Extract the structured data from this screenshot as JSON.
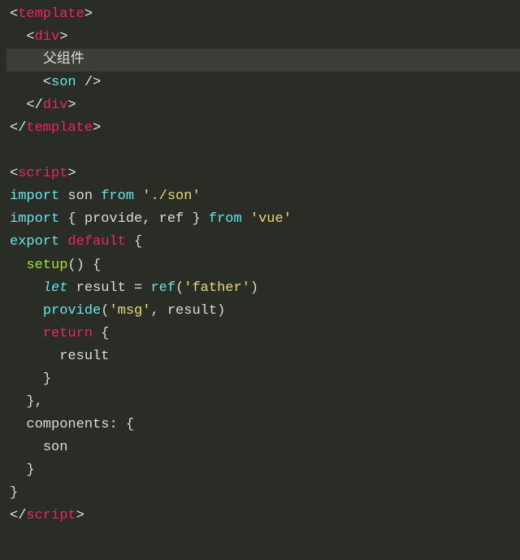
{
  "code": {
    "tags": {
      "template": "template",
      "div": "div",
      "son": "son",
      "script": "script"
    },
    "text": {
      "parent_component": "父组件"
    },
    "keywords": {
      "import": "import",
      "from": "from",
      "export": "export",
      "default": "default",
      "let": "let",
      "return": "return"
    },
    "identifiers": {
      "son": "son",
      "provide": "provide",
      "ref": "ref",
      "setup": "setup",
      "result": "result",
      "msg": "msg",
      "components": "components"
    },
    "strings": {
      "son_path": "'./son'",
      "vue": "'vue'",
      "father": "'father'",
      "msg": "'msg'"
    },
    "punct": {
      "lbrace": "{",
      "rbrace": "}",
      "lparen": "(",
      "rparen": ")",
      "comma": ",",
      "eq": " = ",
      "lt": "<",
      "gt": ">",
      "ltslash": "</",
      "selfclose": " />",
      "colon": ": "
    }
  }
}
